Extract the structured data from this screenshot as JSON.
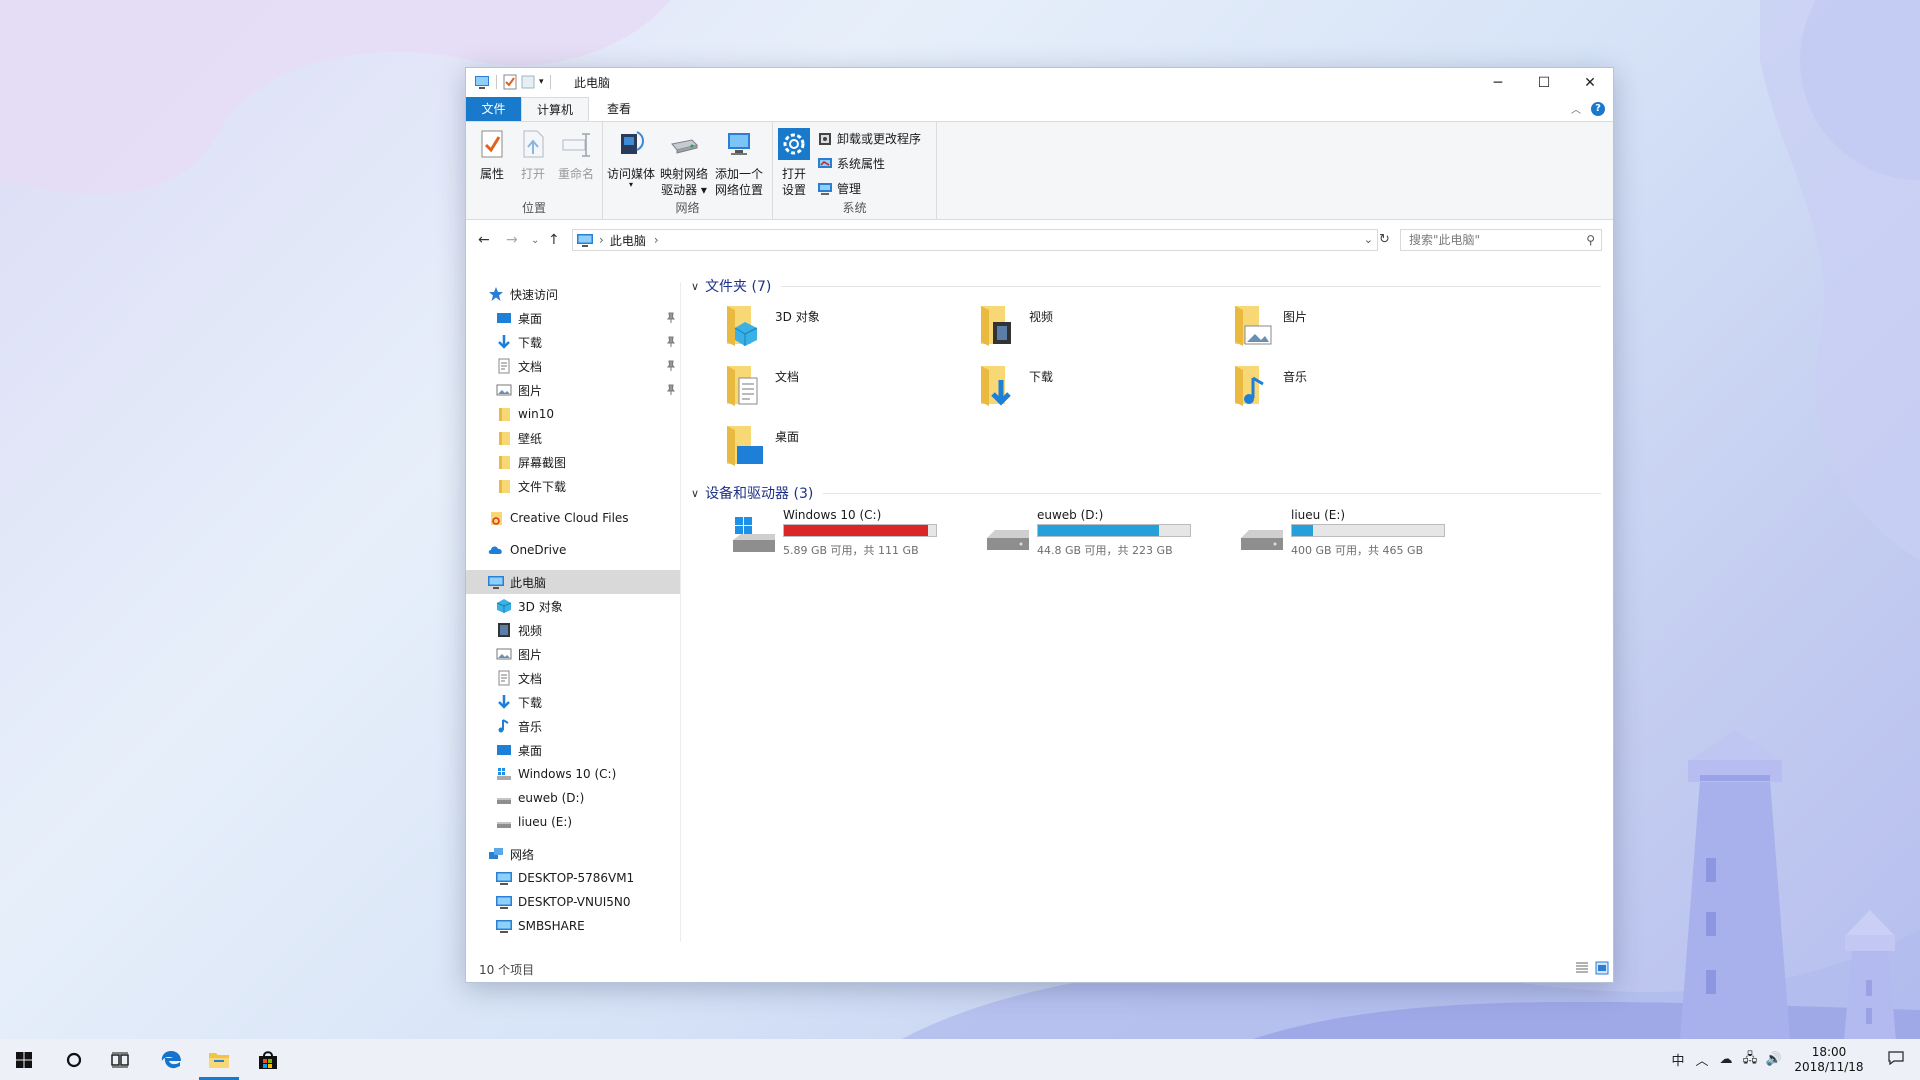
{
  "window": {
    "title": "此电脑",
    "controls": {
      "minimize": "─",
      "maximize": "☐",
      "close": "✕"
    }
  },
  "tabs": {
    "file": "文件",
    "computer": "计算机",
    "view": "查看"
  },
  "ribbon": {
    "location_group": "位置",
    "network_group": "网络",
    "system_group": "系统",
    "properties": "属性",
    "open": "打开",
    "rename": "重命名",
    "access_media": "访问媒体",
    "map_drive_line1": "映射网络",
    "map_drive_line2": "驱动器",
    "add_location_line1": "添加一个",
    "add_location_line2": "网络位置",
    "open_settings_line1": "打开",
    "open_settings_line2": "设置",
    "uninstall": "卸载或更改程序",
    "system_properties": "系统属性",
    "manage": "管理"
  },
  "address": {
    "crumb": "此电脑",
    "search_placeholder": "搜索\"此电脑\""
  },
  "nav": {
    "quick_access": "快速访问",
    "quick_items": [
      "桌面",
      "下载",
      "文档",
      "图片",
      "win10",
      "壁纸",
      "屏幕截图",
      "文件下载"
    ],
    "creative_cloud": "Creative Cloud Files",
    "onedrive": "OneDrive",
    "this_pc": "此电脑",
    "pc_items": [
      "3D 对象",
      "视频",
      "图片",
      "文档",
      "下载",
      "音乐",
      "桌面",
      "Windows 10 (C:)",
      "euweb (D:)",
      "liueu (E:)"
    ],
    "network": "网络",
    "network_items": [
      "DESKTOP-5786VM1",
      "DESKTOP-VNUI5N0",
      "SMBSHARE"
    ]
  },
  "content": {
    "folders_header": "文件夹 (7)",
    "folders": [
      "3D 对象",
      "视频",
      "图片",
      "文档",
      "下载",
      "音乐",
      "桌面"
    ],
    "drives_header": "设备和驱动器 (3)",
    "drives": [
      {
        "name": "Windows 10 (C:)",
        "detail": "5.89 GB 可用，共 111 GB",
        "used_fraction": 0.947,
        "color": "#da2626"
      },
      {
        "name": "euweb (D:)",
        "detail": "44.8 GB 可用，共 223 GB",
        "used_fraction": 0.799,
        "color": "#26a0da"
      },
      {
        "name": "liueu (E:)",
        "detail": "400 GB 可用，共 465 GB",
        "used_fraction": 0.14,
        "color": "#26a0da"
      }
    ]
  },
  "status": {
    "item_count": "10 个项目"
  },
  "taskbar": {
    "ime": "中",
    "time": "18:00",
    "date": "2018/11/18"
  },
  "colors": {
    "accent": "#1979ca",
    "section_header": "#1e3287",
    "selection": "#d9d9d9"
  }
}
